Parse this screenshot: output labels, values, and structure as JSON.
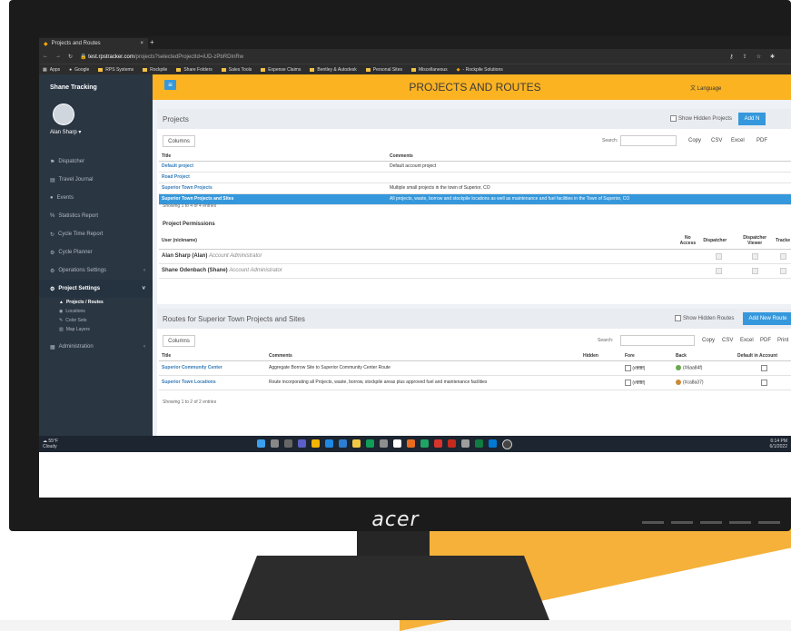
{
  "browser": {
    "tab_title": "Projects and Routes",
    "tab_close": "×",
    "new_tab": "+",
    "url_host": "test.rpstracker.com",
    "url_path": "/projects?selectedProjectId=iUD-zPbRDInRw",
    "bookmarks": [
      "Apps",
      "Google",
      "RPS Systems",
      "Rockpile",
      "Share Folders",
      "Sales Tools",
      "Expense Claims",
      "Bentley & Autodesk",
      "Personal Sites",
      "Miscellaneous",
      "- Rockpile Solutions"
    ]
  },
  "sidebar": {
    "brand": "Shane Tracking",
    "user": "Alan Sharp ▾",
    "items": [
      {
        "label": "Dispatcher",
        "icon": "flag-icon"
      },
      {
        "label": "Travel Journal",
        "icon": "book-icon"
      },
      {
        "label": "Events",
        "icon": "circle-icon"
      },
      {
        "label": "Statistics Report",
        "icon": "percent-icon"
      },
      {
        "label": "Cycle Time Report",
        "icon": "refresh-icon"
      },
      {
        "label": "Cycle Planner",
        "icon": "cogs-icon"
      },
      {
        "label": "Operations Settings",
        "icon": "gear-icon"
      },
      {
        "label": "Project Settings",
        "icon": "gear-icon"
      },
      {
        "label": "Administration",
        "icon": "grid-icon"
      }
    ],
    "sub_items": [
      "Projects / Routes",
      "Locations",
      "Color Sets",
      "Map Layers"
    ],
    "caret": "‹",
    "caret_open": "˅"
  },
  "header": {
    "menu": "≡",
    "title": "PROJECTS AND ROUTES",
    "language": "文 Language"
  },
  "projects": {
    "heading": "Projects",
    "show_hidden": "Show Hidden Projects",
    "add_button": "Add N",
    "columns_button": "Columns",
    "search_label": "Search:",
    "export": [
      "Copy",
      "CSV",
      "Excel",
      "PDF"
    ],
    "headers": [
      "Title",
      "Comments"
    ],
    "rows": [
      {
        "title": "Default project",
        "comments": "Default account project"
      },
      {
        "title": "Road Project",
        "comments": ""
      },
      {
        "title": "Superior Town Projects",
        "comments": "Multiple small projects in the town of Superior, CO"
      },
      {
        "title": "Superior Town Projects and Sites",
        "comments": "All projects, waste, borrow and stockpile locations as well as maintenance and fuel facilities in the Town of Superior, CO"
      }
    ],
    "showing": "Showing 1 to 4 of 4 entries"
  },
  "permissions": {
    "heading": "Project Permissions",
    "headers": [
      "User (nickname)",
      "No Access",
      "Dispatcher",
      "Dispatcher Viewer",
      "Tracke"
    ],
    "rows": [
      {
        "user": "Alan Sharp (Alan)",
        "role": "Account Administrator"
      },
      {
        "user": "Shane Odenbach (Shane)",
        "role": "Account Administrator"
      }
    ]
  },
  "routes": {
    "heading": "Routes for Superior Town Projects and Sites",
    "show_hidden": "Show Hidden Routes",
    "add_button": "Add New Route",
    "columns_button": "Columns",
    "search_label": "Search:",
    "export": [
      "Copy",
      "CSV",
      "Excel",
      "PDF",
      "Print"
    ],
    "headers": [
      "Title",
      "Comments",
      "Hidden",
      "Fore",
      "Back",
      "Default in Account"
    ],
    "rows": [
      {
        "title": "Superior Community Center",
        "comments": "Aggregate Borrow Site to Superior Community Center Route",
        "fore": "(#ffffff)",
        "back": "(#6aa84f)",
        "back_color": "#6aa84f"
      },
      {
        "title": "Superior Town Locations",
        "comments": "Route incorporating all Projects, waste, borrow, stockpile areas plus approved fuel and maintenance facilities",
        "fore": "(#ffffff)",
        "back": "(#ca8a37)",
        "back_color": "#ca8a37"
      }
    ],
    "showing": "Showing 1 to 2 of 2 entries"
  },
  "taskbar": {
    "temp": "55°F",
    "weather": "Cloudy",
    "time": "6:14 PM",
    "date": "6/1/2022"
  },
  "monitor": {
    "brand": "acer"
  },
  "colors": {
    "accent": "#fcb322",
    "primary": "#3598dc",
    "sidebar": "#2b3643"
  }
}
